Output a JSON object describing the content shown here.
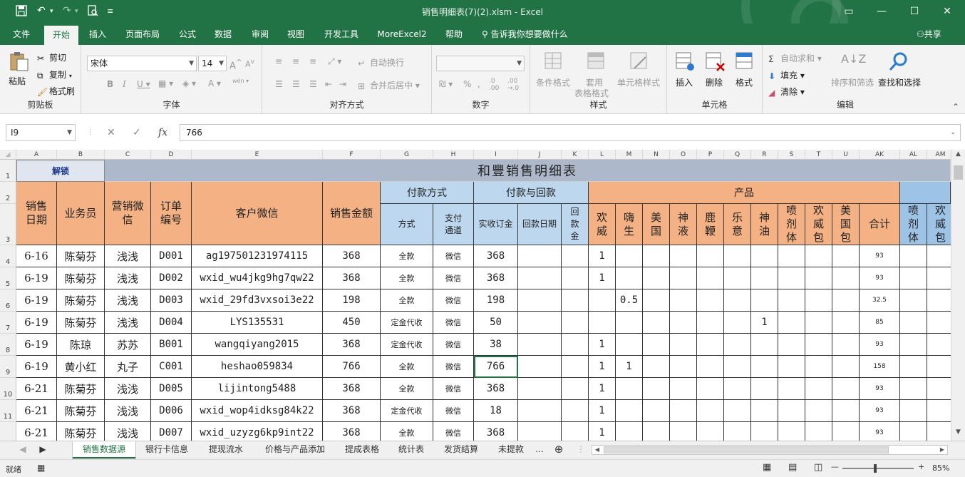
{
  "window": {
    "title": "销售明细表(7)(2).xlsm  -  Excel"
  },
  "menu": {
    "tabs": [
      "文件",
      "开始",
      "插入",
      "页面布局",
      "公式",
      "数据",
      "审阅",
      "视图",
      "开发工具",
      "MoreExcel2",
      "帮助"
    ],
    "active_tab": "开始",
    "tell_me": "告诉我你想要做什么",
    "share": "共享"
  },
  "ribbon": {
    "clipboard": {
      "paste": "粘贴",
      "cut": "剪切",
      "copy": "复制",
      "format_painter": "格式刷",
      "label": "剪贴板"
    },
    "font": {
      "name": "宋体",
      "size": "14",
      "label": "字体"
    },
    "alignment": {
      "wrap": "自动换行",
      "merge": "合并后居中",
      "label": "对齐方式"
    },
    "number": {
      "format": "",
      "label": "数字"
    },
    "styles": {
      "conditional": "条件格式",
      "table_l1": "套用",
      "table_l2": "表格格式",
      "cell_styles": "单元格样式",
      "label": "样式"
    },
    "cells": {
      "insert": "插入",
      "delete": "删除",
      "format": "格式",
      "label": "单元格"
    },
    "editing": {
      "autosum": "自动求和",
      "fill": "填充",
      "clear": "清除",
      "sort": "排序和筛选",
      "find": "查找和选择",
      "label": "编辑"
    }
  },
  "formula_bar": {
    "name_box": "I9",
    "value": "766"
  },
  "sheet": {
    "columns": [
      "A",
      "B",
      "C",
      "D",
      "E",
      "F",
      "G",
      "H",
      "I",
      "J",
      "K",
      "L",
      "M",
      "N",
      "O",
      "P",
      "Q",
      "R",
      "S",
      "T",
      "U",
      "AK",
      "AL",
      "AM"
    ],
    "rows": [
      "1",
      "2",
      "3",
      "4",
      "5",
      "6",
      "7",
      "8",
      "9",
      "10",
      "11"
    ],
    "unlock_button": "解锁",
    "title": "和豐销售明细表",
    "headers": {
      "date": "销售日期",
      "salesman": "业务员",
      "marketing": "营销微信",
      "order": "订单编号",
      "customer": "客户微信",
      "amount": "销售金额",
      "pay_group": "付款方式",
      "collect_group": "付款与回款",
      "product_group": "产品",
      "method": "方式",
      "channel": "支付通道",
      "received": "实收订金",
      "return_date": "回款日期",
      "return_amt": "回款金",
      "products": [
        "欢威",
        "嗨生",
        "美国",
        "神液",
        "鹿鞭",
        "乐意",
        "神油",
        "喷剂体",
        "欢威包",
        "美国包"
      ],
      "total": "合计",
      "extra": [
        "喷剂体",
        "欢威包"
      ]
    },
    "data_rows": [
      {
        "date": "6-16",
        "salesman": "陈菊芬",
        "marketing": "浅浅",
        "order": "D001",
        "customer": "ag197501231974115",
        "amount": "368",
        "method": "全款",
        "channel": "微信",
        "received": "368",
        "l": "1",
        "m": "",
        "r": "",
        "total": "93"
      },
      {
        "date": "6-19",
        "salesman": "陈菊芬",
        "marketing": "浅浅",
        "order": "D002",
        "customer": "wxid_wu4jkg9hg7qw22",
        "amount": "368",
        "method": "全款",
        "channel": "微信",
        "received": "368",
        "l": "1",
        "m": "",
        "r": "",
        "total": "93"
      },
      {
        "date": "6-19",
        "salesman": "陈菊芬",
        "marketing": "浅浅",
        "order": "D003",
        "customer": "wxid_29fd3vxsoi3e22",
        "amount": "198",
        "method": "全款",
        "channel": "微信",
        "received": "198",
        "l": "",
        "m": "0.5",
        "r": "",
        "total": "32.5"
      },
      {
        "date": "6-19",
        "salesman": "陈菊芬",
        "marketing": "浅浅",
        "order": "D004",
        "customer": "LYS135531",
        "amount": "450",
        "method": "定金代收",
        "channel": "微信",
        "received": "50",
        "l": "",
        "m": "",
        "r": "1",
        "total": "85"
      },
      {
        "date": "6-19",
        "salesman": "陈琼",
        "marketing": "苏苏",
        "order": "B001",
        "customer": "wangqiyang2015",
        "amount": "368",
        "method": "定金代收",
        "channel": "微信",
        "received": "38",
        "l": "1",
        "m": "",
        "r": "",
        "total": "93"
      },
      {
        "date": "6-19",
        "salesman": "黄小红",
        "marketing": "丸子",
        "order": "C001",
        "customer": "heshao059834",
        "amount": "766",
        "method": "全款",
        "channel": "微信",
        "received": "766",
        "l": "1",
        "m": "1",
        "r": "",
        "total": "158"
      },
      {
        "date": "6-21",
        "salesman": "陈菊芬",
        "marketing": "浅浅",
        "order": "D005",
        "customer": "lijintong5488",
        "amount": "368",
        "method": "全款",
        "channel": "微信",
        "received": "368",
        "l": "1",
        "m": "",
        "r": "",
        "total": "93"
      },
      {
        "date": "6-21",
        "salesman": "陈菊芬",
        "marketing": "浅浅",
        "order": "D006",
        "customer": "wxid_wop4idksg84k22",
        "amount": "368",
        "method": "定金代收",
        "channel": "微信",
        "received": "18",
        "l": "1",
        "m": "",
        "r": "",
        "total": "93"
      },
      {
        "date": "6-21",
        "salesman": "陈菊芬",
        "marketing": "浅浅",
        "order": "D007",
        "customer": "wxid_uzyzg6kp9int22",
        "amount": "368",
        "method": "全款",
        "channel": "微信",
        "received": "368",
        "l": "1",
        "m": "",
        "r": "",
        "total": "93"
      }
    ]
  },
  "sheet_tabs": [
    "销售数据源",
    "银行卡信息",
    "提现流水",
    "价格与产品添加",
    "提成表格",
    "统计表",
    "发货结算",
    "未提款"
  ],
  "active_sheet_tab": "销售数据源",
  "tabbar_more": "...",
  "status": {
    "ready": "就绪",
    "zoom": "85%"
  },
  "colors": {
    "excel_green": "#217346",
    "header_orange": "#f4b184",
    "header_blue": "#bdd7ee",
    "title_band": "#adb9ca"
  }
}
